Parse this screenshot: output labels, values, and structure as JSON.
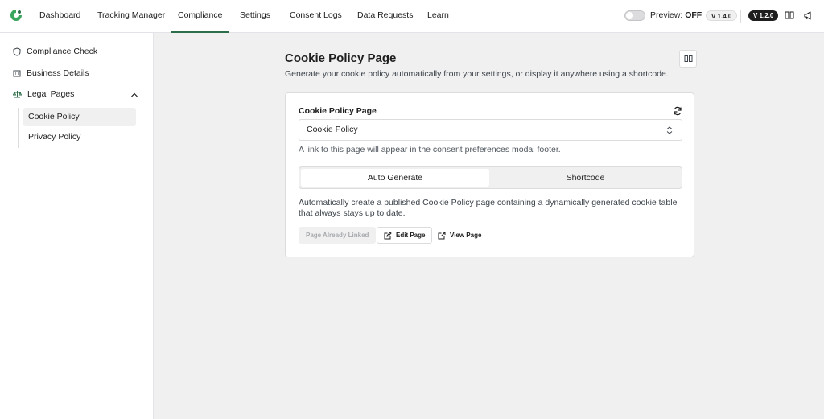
{
  "nav": {
    "items": [
      "Dashboard",
      "Tracking Manager",
      "Compliance",
      "Settings",
      "Consent Logs",
      "Data Requests",
      "Learn"
    ],
    "active": "Compliance",
    "preview_label": "Preview:",
    "preview_state": "OFF",
    "version_1": "V 1.4.0",
    "version_2": "V 1.2.0"
  },
  "sidebar": {
    "items": [
      "Compliance Check",
      "Business Details",
      "Legal Pages"
    ],
    "sub_items": [
      "Cookie Policy",
      "Privacy Policy"
    ],
    "active_sub": "Cookie Policy"
  },
  "main": {
    "title": "Cookie Policy Page",
    "subtitle": "Generate your cookie policy automatically from your settings, or display it anywhere using a shortcode.",
    "card": {
      "field_label": "Cookie Policy Page",
      "select_value": "Cookie Policy",
      "help_text": "A link to this page will appear in the consent preferences modal footer.",
      "tabs": [
        "Auto Generate",
        "Shortcode"
      ],
      "active_tab": "Auto Generate",
      "description": "Automatically create a published Cookie Policy page containing a dynamically generated cookie table that always stays up to date.",
      "buttons": {
        "linked": "Page Already Linked",
        "edit": "Edit Page",
        "view": "View Page"
      }
    }
  },
  "colors": {
    "accent": "#2c6e49",
    "background": "#f0f0f1"
  },
  "icons": [
    "logo-icon",
    "book-icon",
    "megaphone-icon",
    "shield-icon",
    "building-icon",
    "scales-icon",
    "chevron-up-icon",
    "refresh-icon",
    "chevron-updown-icon",
    "edit-icon",
    "external-link-icon"
  ]
}
